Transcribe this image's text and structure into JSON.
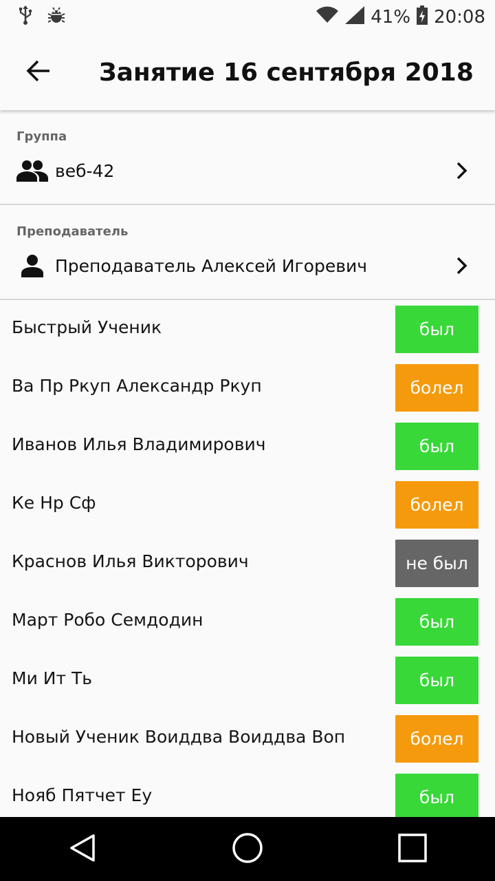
{
  "status_bar": {
    "battery_percent": "41%",
    "time": "20:08",
    "icons": [
      "usb-icon",
      "android-debug-icon",
      "wifi-icon",
      "signal-icon",
      "battery-icon"
    ]
  },
  "app_bar": {
    "title": "Занятие 16 сентября 2018",
    "back_icon": "arrow-back-icon"
  },
  "group": {
    "label": "Группа",
    "value": "веб-42",
    "icon": "group-icon"
  },
  "teacher": {
    "label": "Преподаватель",
    "value": "Преподаватель Алексей Игоревич",
    "icon": "person-icon"
  },
  "status_colors": {
    "был": "#38d838",
    "болел": "#f59a0c",
    "не был": "#666666"
  },
  "students": [
    {
      "name": "Быстрый Ученик",
      "status": "был"
    },
    {
      "name": "Ва Пр Ркуп Александр Ркуп",
      "status": "болел"
    },
    {
      "name": "Иванов Илья Владимирович",
      "status": "был"
    },
    {
      "name": "Ке Нр Сф",
      "status": "болел"
    },
    {
      "name": "Краснов Илья Викторович",
      "status": "не был"
    },
    {
      "name": "Март Робо Семдодин",
      "status": "был"
    },
    {
      "name": "Ми Ит Ть",
      "status": "был"
    },
    {
      "name": "Новый Ученик Воиддва Воиддва Воп",
      "status": "болел"
    },
    {
      "name": "Нояб Пятчет Еу",
      "status": "был"
    }
  ],
  "nav_bar": {
    "icons": [
      "back-triangle-icon",
      "home-circle-icon",
      "recents-square-icon"
    ]
  }
}
